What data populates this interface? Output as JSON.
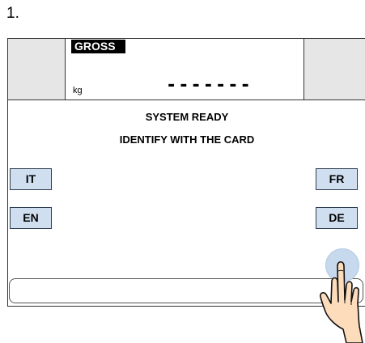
{
  "step": {
    "number": "1."
  },
  "header": {
    "gross_label": "GROSS",
    "unit": "kg",
    "weight_display": "-------"
  },
  "messages": {
    "line1": "SYSTEM READY",
    "line2": "IDENTIFY WITH THE CARD"
  },
  "language_buttons": {
    "it": "IT",
    "en": "EN",
    "fr": "FR",
    "de": "DE"
  },
  "card_field": {
    "value": ""
  },
  "icons": {
    "touch": "touch-indicator-icon",
    "hand": "pointing-hand-icon"
  },
  "colors": {
    "button_fill": "#d0dff0",
    "side_panel": "#e6e6e6",
    "touch_indicator": "#c6d9ed",
    "gross_badge": "#000000"
  }
}
